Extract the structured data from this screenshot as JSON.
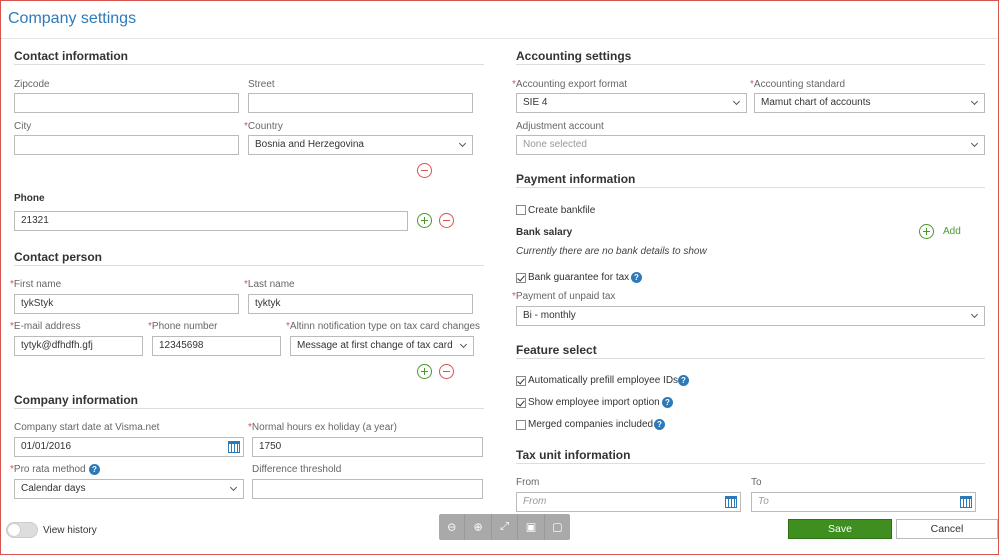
{
  "title": "Company settings",
  "contact_info": {
    "heading": "Contact information",
    "zipcode_label": "Zipcode",
    "zipcode_value": "",
    "street_label": "Street",
    "street_value": "",
    "city_label": "City",
    "city_value": "",
    "country_label": "Country",
    "country_value": "Bosnia and Herzegovina",
    "phone_label": "Phone",
    "phone_value": "21321"
  },
  "contact_person": {
    "heading": "Contact person",
    "first_name_label": "First name",
    "first_name_value": "tykStyk",
    "last_name_label": "Last name",
    "last_name_value": "tyktyk",
    "email_label": "E-mail address",
    "email_value": "tytyk@dfhdfh.gfj",
    "phone_label": "Phone number",
    "phone_value": "12345698",
    "altinn_label": "Altinn notification type on tax card changes",
    "altinn_value": "Message at first change of tax card"
  },
  "company_info": {
    "heading": "Company information",
    "start_date_label": "Company start date at Visma.net",
    "start_date_value": "01/01/2016",
    "normal_hours_label": "Normal hours ex holiday (a year)",
    "normal_hours_value": "1750",
    "pro_rata_label": "Pro rata method",
    "pro_rata_value": "Calendar days",
    "diff_threshold_label": "Difference threshold",
    "diff_threshold_value": ""
  },
  "accounting": {
    "heading": "Accounting settings",
    "export_format_label": "Accounting export format",
    "export_format_value": "SIE 4",
    "standard_label": "Accounting standard",
    "standard_value": "Mamut chart of accounts",
    "adjustment_label": "Adjustment account",
    "adjustment_value": "None selected"
  },
  "payment": {
    "heading": "Payment information",
    "create_bankfile_label": "Create bankfile",
    "create_bankfile_checked": false,
    "bank_salary_label": "Bank salary",
    "add_label": "Add",
    "no_bank_details": "Currently there are no bank details to show",
    "bank_guarantee_label": "Bank guarantee for tax",
    "bank_guarantee_checked": true,
    "unpaid_tax_label": "Payment of unpaid tax",
    "unpaid_tax_value": "Bi - monthly"
  },
  "feature_select": {
    "heading": "Feature select",
    "prefill_label": "Automatically prefill employee IDs",
    "prefill_checked": true,
    "import_label": "Show employee import option",
    "import_checked": true,
    "merged_label": "Merged companies included",
    "merged_checked": false
  },
  "tax_unit": {
    "heading": "Tax unit information",
    "from_label": "From",
    "from_placeholder": "From",
    "to_label": "To",
    "to_placeholder": "To"
  },
  "footer": {
    "view_history_label": "View history",
    "save_label": "Save",
    "cancel_label": "Cancel",
    "zoom_icons": [
      "zoom-out-icon",
      "zoom-in-icon",
      "fit-screen-icon",
      "screen-comment-icon",
      "comment-icon"
    ]
  },
  "colors": {
    "accent": "#2e7ab8",
    "required": "#d9534f",
    "save": "#3e8e20",
    "add": "#4a9a2a"
  },
  "required_mark": "*",
  "help_mark": "?"
}
